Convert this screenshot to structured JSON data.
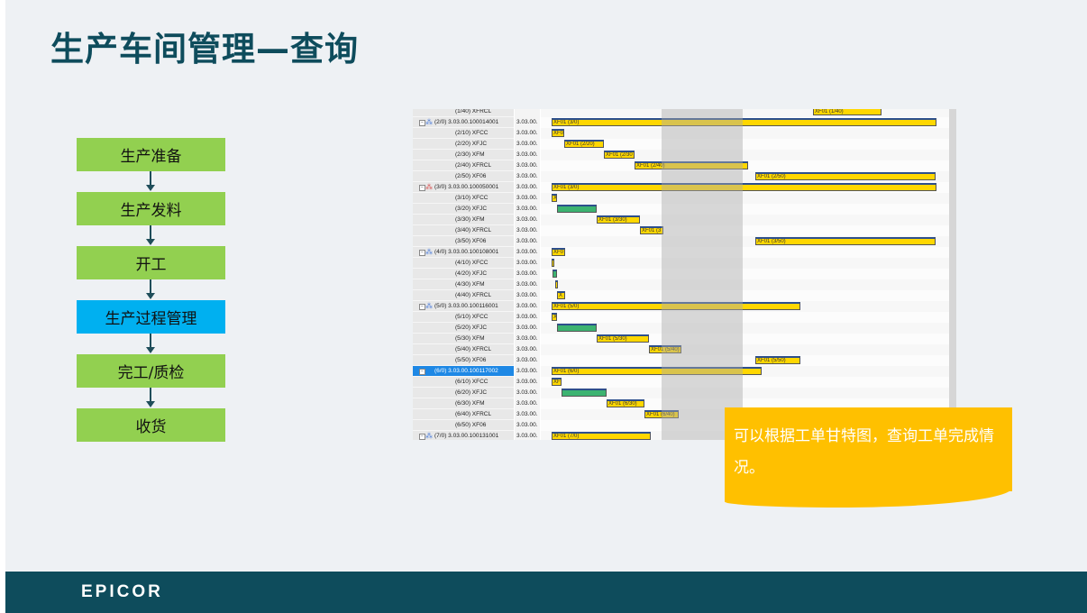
{
  "title": "生产车间管理—查询",
  "flow": [
    "生产准备",
    "生产发料",
    "开工",
    "生产过程管理",
    "完工/质检",
    "收货"
  ],
  "flow_active_index": 3,
  "gantt": {
    "rows": [
      {
        "label": "(1/40) XFRCL",
        "col2": "",
        "bars": [
          {
            "text": "XF01 (1/40)"
          }
        ]
      },
      {
        "label": "(2/0) 3.03.00.100014001",
        "col2": "3.03.00.",
        "bars": [
          {
            "text": "XF01 (3/0)"
          }
        ]
      },
      {
        "label": "(2/10) XFCC",
        "col2": "3.03.00.",
        "bars": [
          {
            "text": "XF0"
          }
        ]
      },
      {
        "label": "(2/20) XFJC",
        "col2": "3.03.00.",
        "bars": [
          {
            "text": "XF01 (2/20)"
          }
        ]
      },
      {
        "label": "(2/30) XFM",
        "col2": "3.03.00.",
        "bars": [
          {
            "text": "XF01 (2/30"
          }
        ]
      },
      {
        "label": "(2/40) XFRCL",
        "col2": "3.03.00.",
        "bars": [
          {
            "text": "XF01 (2/40)"
          }
        ]
      },
      {
        "label": "(2/50) XF06",
        "col2": "3.03.00.",
        "bars": [
          {
            "text": "XF01 (2/50)"
          }
        ]
      },
      {
        "label": "(3/0) 3.03.00.100050001",
        "col2": "3.03.00.",
        "bars": [
          {
            "text": "XF01 (3/0)"
          }
        ]
      },
      {
        "label": "(3/10) XFCC",
        "col2": "3.03.00.",
        "bars": [
          {
            "text": "X"
          }
        ]
      },
      {
        "label": "(3/20) XFJC",
        "col2": "3.03.00.",
        "bars": [
          {
            "text": ""
          }
        ]
      },
      {
        "label": "(3/30) XFM",
        "col2": "3.03.00.",
        "bars": [
          {
            "text": "XF01 (3/30)"
          }
        ]
      },
      {
        "label": "(3/40) XFRCL",
        "col2": "3.03.00.",
        "bars": [
          {
            "text": "XF01 (3"
          }
        ]
      },
      {
        "label": "(3/50) XF06",
        "col2": "3.03.00.",
        "bars": [
          {
            "text": "XF01 (3/50)"
          }
        ]
      },
      {
        "label": "(4/0) 3.03.00.100108001",
        "col2": "3.03.00.",
        "bars": [
          {
            "text": "XF0"
          }
        ]
      },
      {
        "label": "(4/10) XFCC",
        "col2": "3.03.00.",
        "bars": [
          {
            "text": ""
          }
        ]
      },
      {
        "label": "(4/20) XFJC",
        "col2": "3.03.00.",
        "bars": [
          {
            "text": ""
          }
        ]
      },
      {
        "label": "(4/30) XFM",
        "col2": "3.03.00.",
        "bars": [
          {
            "text": ""
          }
        ]
      },
      {
        "label": "(4/40) XFRCL",
        "col2": "3.03.00.",
        "bars": [
          {
            "text": "X"
          }
        ]
      },
      {
        "label": "(5/0) 3.03.00.100116001",
        "col2": "3.03.00.",
        "bars": [
          {
            "text": "XF01 (5/0)"
          }
        ]
      },
      {
        "label": "(5/10) XFCC",
        "col2": "3.03.00.",
        "bars": [
          {
            "text": "X"
          }
        ]
      },
      {
        "label": "(5/20) XFJC",
        "col2": "3.03.00.",
        "bars": [
          {
            "text": ""
          }
        ]
      },
      {
        "label": "(5/30) XFM",
        "col2": "3.03.00.",
        "bars": [
          {
            "text": "XF01 (5/30)"
          }
        ]
      },
      {
        "label": "(5/40) XFRCL",
        "col2": "3.03.00.",
        "bars": [
          {
            "text": "XF01 (5/40)"
          }
        ]
      },
      {
        "label": "(5/50) XF06",
        "col2": "3.03.00.",
        "bars": [
          {
            "text": "XF01 (5/50)"
          }
        ]
      },
      {
        "label": "(6/0) 3.03.00.100117002",
        "col2": "3.03.00.",
        "bars": [
          {
            "text": "XF01 (6/0)"
          }
        ]
      },
      {
        "label": "(6/10) XFCC",
        "col2": "3.03.00.",
        "bars": [
          {
            "text": "XF"
          }
        ]
      },
      {
        "label": "(6/20) XFJC",
        "col2": "3.03.00.",
        "bars": [
          {
            "text": ""
          }
        ]
      },
      {
        "label": "(6/30) XFM",
        "col2": "3.03.00.",
        "bars": [
          {
            "text": "XF01 (6/30)"
          }
        ]
      },
      {
        "label": "(6/40) XFRCL",
        "col2": "3.03.00.",
        "bars": [
          {
            "text": "XF01 (6/40)"
          }
        ]
      },
      {
        "label": "(6/50) XF06",
        "col2": "3.03.00.",
        "bars": [
          {
            "text": ""
          }
        ]
      },
      {
        "label": "(7/0) 3.03.00.100131001",
        "col2": "3.03.00.",
        "bars": [
          {
            "text": "XF01 (7/0)"
          }
        ]
      }
    ]
  },
  "callout": "可以根据工单甘特图，查询工单完成情况。",
  "footer_logo": "EPICOR",
  "colors": {
    "title": "#0e4c5c",
    "flow_default": "#92d050",
    "flow_active": "#00b0f0",
    "callout": "#ffc000",
    "footer": "#0e4c5c",
    "bar_yellow": "#ffd700",
    "bar_green": "#3cb371",
    "selection": "#1e88e5"
  }
}
